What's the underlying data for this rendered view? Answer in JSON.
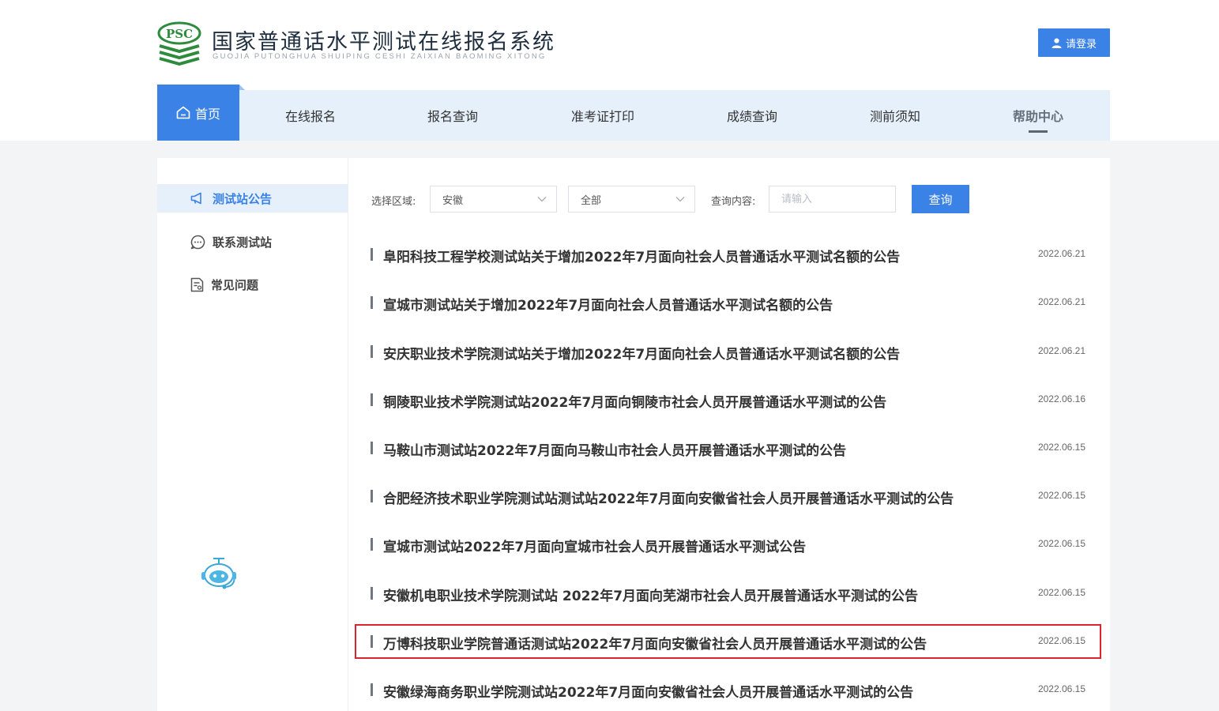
{
  "header": {
    "logo_text": "PSC",
    "title": "国家普通话水平测试在线报名系统",
    "subtitle": "GUOJIA PUTONGHUA SHUIPING CESHI ZAIXIAN BAOMING XITONG",
    "login_label": "请登录"
  },
  "nav": {
    "items": [
      {
        "label": "首页"
      },
      {
        "label": "在线报名"
      },
      {
        "label": "报名查询"
      },
      {
        "label": "准考证打印"
      },
      {
        "label": "成绩查询"
      },
      {
        "label": "测前须知"
      },
      {
        "label": "帮助中心"
      }
    ]
  },
  "sidebar": {
    "items": [
      {
        "label": "测试站公告",
        "icon": "megaphone-icon",
        "active": true
      },
      {
        "label": "联系测试站",
        "icon": "chat-icon",
        "active": false
      },
      {
        "label": "常见问题",
        "icon": "document-icon",
        "active": false
      }
    ]
  },
  "filters": {
    "region_label": "选择区域:",
    "region_value": "安徽",
    "category_value": "全部",
    "query_label": "查询内容:",
    "query_placeholder": "请输入",
    "search_label": "查询"
  },
  "announcements": [
    {
      "title": "阜阳科技工程学校测试站关于增加2022年7月面向社会人员普通话水平测试名额的公告",
      "date": "2022.06.21"
    },
    {
      "title": "宣城市测试站关于增加2022年7月面向社会人员普通话水平测试名额的公告",
      "date": "2022.06.21"
    },
    {
      "title": "安庆职业技术学院测试站关于增加2022年7月面向社会人员普通话水平测试名额的公告",
      "date": "2022.06.21"
    },
    {
      "title": "铜陵职业技术学院测试站2022年7月面向铜陵市社会人员开展普通话水平测试的公告",
      "date": "2022.06.16"
    },
    {
      "title": "马鞍山市测试站2022年7月面向马鞍山市社会人员开展普通话水平测试的公告",
      "date": "2022.06.15"
    },
    {
      "title": "合肥经济技术职业学院测试站测试站2022年7月面向安徽省社会人员开展普通话水平测试的公告",
      "date": "2022.06.15"
    },
    {
      "title": "宣城市测试站2022年7月面向宣城市社会人员开展普通话水平测试公告",
      "date": "2022.06.15"
    },
    {
      "title": "安徽机电职业技术学院测试站 2022年7月面向芜湖市社会人员开展普通话水平测试的公告",
      "date": "2022.06.15"
    },
    {
      "title": "万博科技职业学院普通话测试站2022年7月面向安徽省社会人员开展普通话水平测试的公告",
      "date": "2022.06.15",
      "highlighted": true
    },
    {
      "title": "安徽绿海商务职业学院测试站2022年7月面向安徽省社会人员开展普通话水平测试的公告",
      "date": "2022.06.15"
    }
  ],
  "colors": {
    "primary": "#3b82e6",
    "nav_bg": "#e6f0fb",
    "highlight_border": "#d9232e",
    "logo_green": "#2e8b3d"
  }
}
